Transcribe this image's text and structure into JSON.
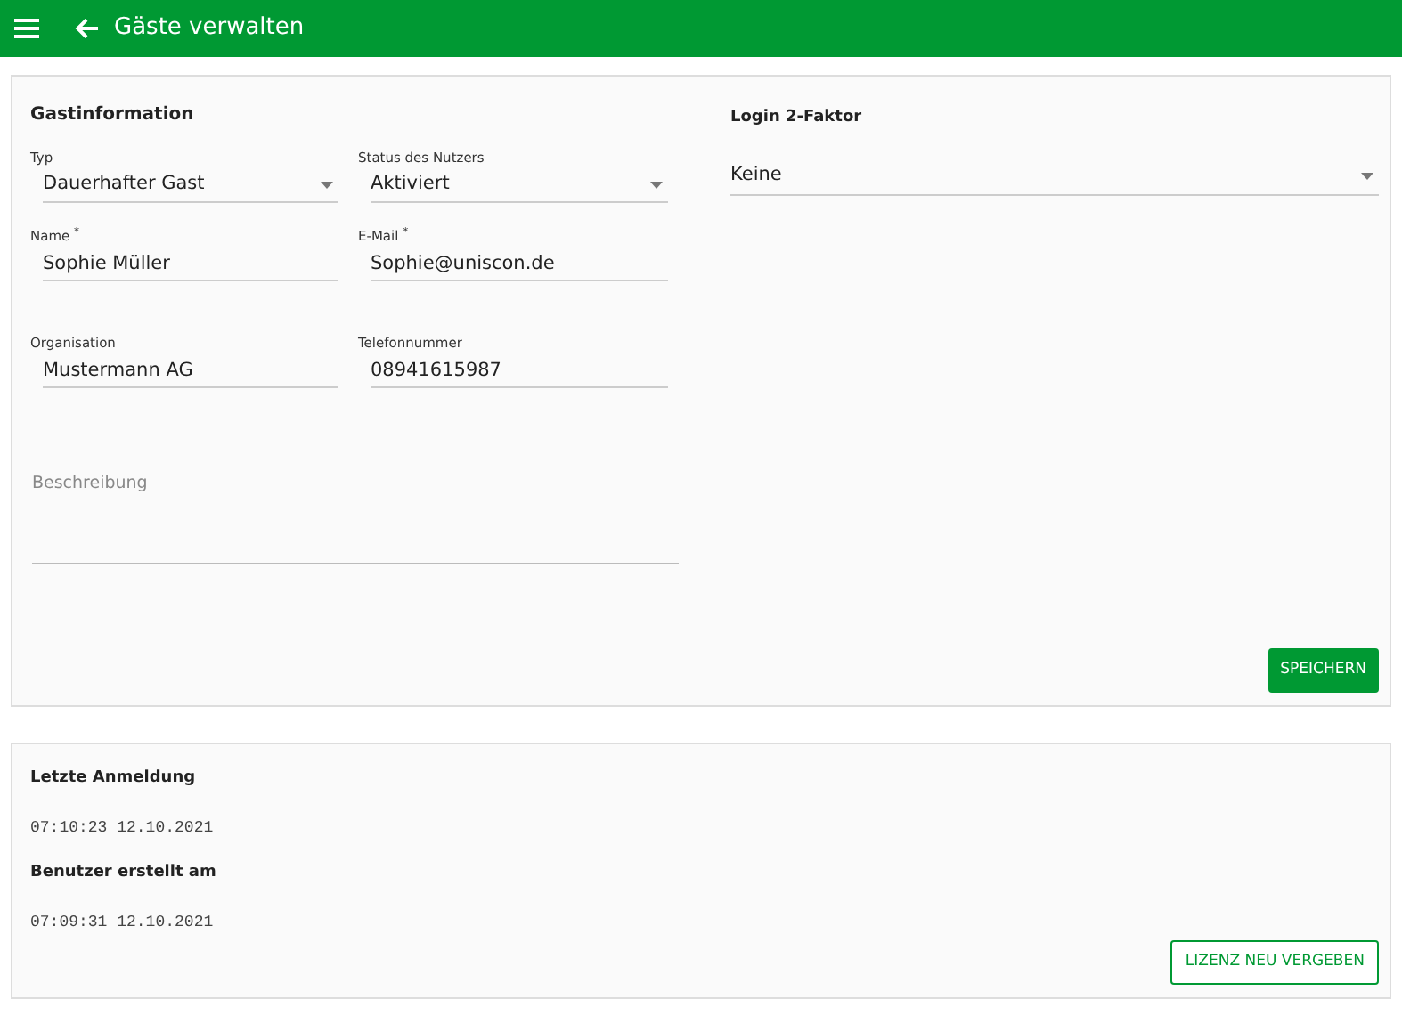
{
  "app_bar": {
    "title": "Gäste verwalten"
  },
  "guest_info": {
    "title": "Gastinformation",
    "fields": [
      {
        "kind": "select",
        "label": "Typ",
        "value": "Dauerhafter Gast"
      },
      {
        "kind": "select",
        "label": "Status des Nutzers",
        "value": "Aktiviert"
      },
      {
        "kind": "text",
        "label": "Name $^{*}$",
        "value": "Sophie Müller"
      },
      {
        "kind": "text",
        "label": "E-Mail $^{*}$",
        "value": "Sophie@uniscon.de"
      },
      {
        "kind": "text",
        "label": "Organisation",
        "value": "Mustermann AG"
      },
      {
        "kind": "text",
        "label": "Telefonnummer",
        "value": "08941615987"
      }
    ],
    "description": {
      "placeholder": "Beschreibung"
    },
    "two_factor": {
      "title": "Login 2-Faktor",
      "value": "Keine"
    },
    "save_button": "SPEICHERN"
  },
  "activity": {
    "items": [
      {
        "label": "Letzte Anmeldung",
        "value": "07:10:23 12.10.2021"
      },
      {
        "label": "Benutzer erstellt am",
        "value": "07:09:31 12.10.2021"
      }
    ],
    "button": "LIZENZ NEU VERGEBEN"
  }
}
